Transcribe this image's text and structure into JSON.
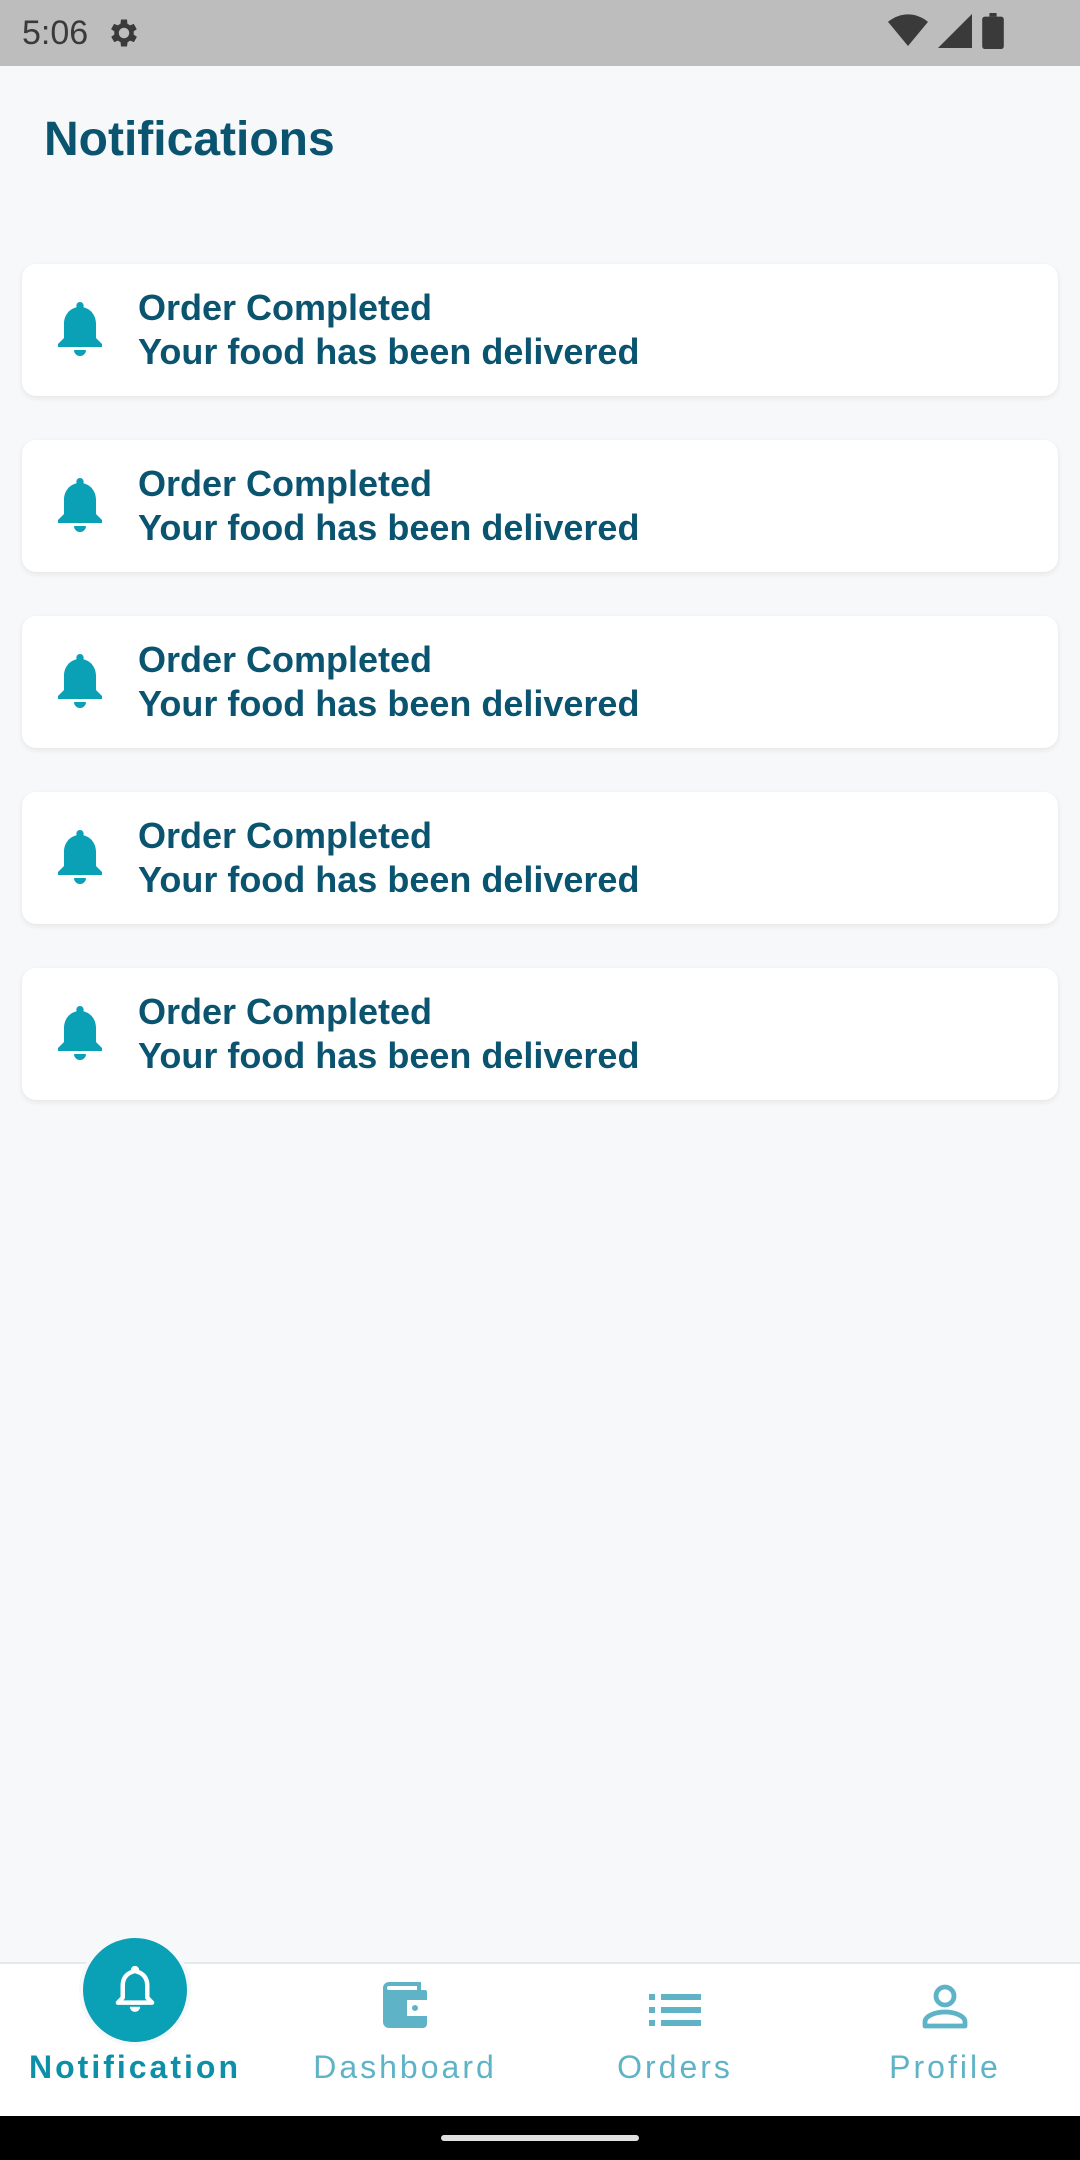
{
  "status_bar": {
    "time": "5:06",
    "icons": [
      "gear-icon",
      "wifi-icon",
      "signal-icon",
      "battery-icon"
    ]
  },
  "page": {
    "title": "Notifications"
  },
  "notifications": [
    {
      "title": "Order Completed",
      "body": "Your food has been delivered",
      "icon": "bell-icon"
    },
    {
      "title": "Order Completed",
      "body": "Your food has been delivered",
      "icon": "bell-icon"
    },
    {
      "title": "Order Completed",
      "body": "Your food has been delivered",
      "icon": "bell-icon"
    },
    {
      "title": "Order Completed",
      "body": "Your food has been delivered",
      "icon": "bell-icon"
    },
    {
      "title": "Order Completed",
      "body": "Your food has been delivered",
      "icon": "bell-icon"
    }
  ],
  "bottom_nav": {
    "items": [
      {
        "label": "Notification",
        "icon": "bell-outline-icon",
        "active": true
      },
      {
        "label": "Dashboard",
        "icon": "wallet-icon",
        "active": false
      },
      {
        "label": "Orders",
        "icon": "list-icon",
        "active": false
      },
      {
        "label": "Profile",
        "icon": "person-icon",
        "active": false
      }
    ]
  },
  "colors": {
    "primary_text": "#0a5470",
    "accent": "#0aa1b7",
    "nav_inactive": "#5fb3c6",
    "background": "#f7f8f9"
  }
}
